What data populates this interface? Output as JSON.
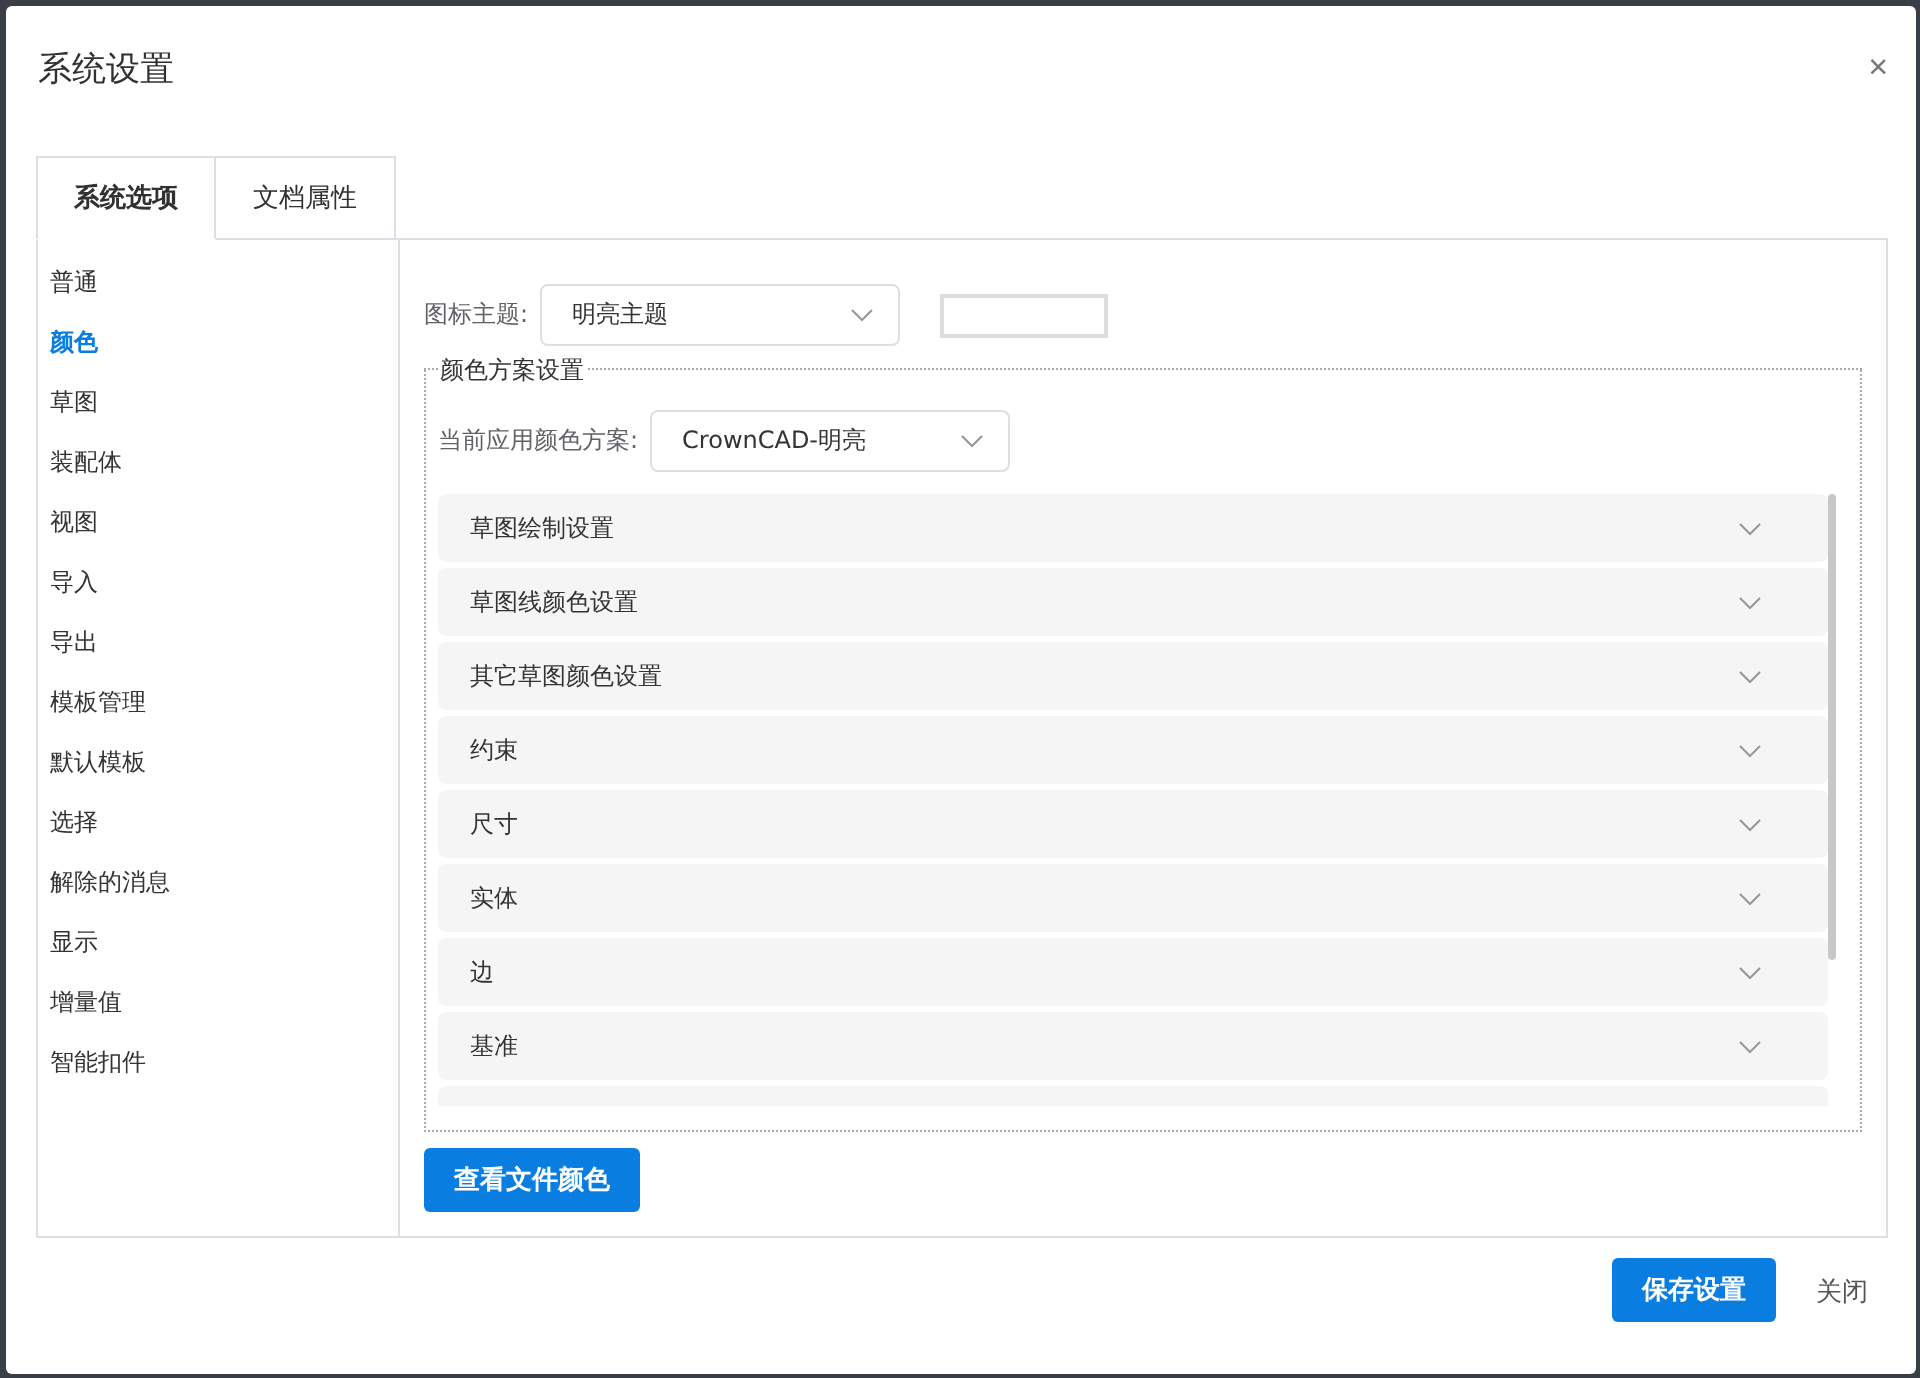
{
  "dialog": {
    "title": "系统设置",
    "close": "×"
  },
  "tabs": [
    {
      "label": "系统选项",
      "selected": true
    },
    {
      "label": "文档属性",
      "selected": false
    }
  ],
  "sidebar": {
    "items": [
      {
        "label": "普通",
        "selected": false
      },
      {
        "label": "颜色",
        "selected": true
      },
      {
        "label": "草图",
        "selected": false
      },
      {
        "label": "装配体",
        "selected": false
      },
      {
        "label": "视图",
        "selected": false
      },
      {
        "label": "导入",
        "selected": false
      },
      {
        "label": "导出",
        "selected": false
      },
      {
        "label": "模板管理",
        "selected": false
      },
      {
        "label": "默认模板",
        "selected": false
      },
      {
        "label": "选择",
        "selected": false
      },
      {
        "label": "解除的消息",
        "selected": false
      },
      {
        "label": "显示",
        "selected": false
      },
      {
        "label": "增量值",
        "selected": false
      },
      {
        "label": "智能扣件",
        "selected": false
      }
    ]
  },
  "icon_theme": {
    "label": "图标主题:",
    "value": "明亮主题"
  },
  "color_scheme": {
    "legend": "颜色方案设置",
    "label": "当前应用颜色方案:",
    "value": "CrownCAD-明亮",
    "sections": [
      {
        "label": "草图绘制设置",
        "expanded": false
      },
      {
        "label": "草图线颜色设置",
        "expanded": false
      },
      {
        "label": "其它草图颜色设置",
        "expanded": false
      },
      {
        "label": "约束",
        "expanded": false
      },
      {
        "label": "尺寸",
        "expanded": false
      },
      {
        "label": "实体",
        "expanded": false
      },
      {
        "label": "边",
        "expanded": false
      },
      {
        "label": "基准",
        "expanded": false
      }
    ]
  },
  "view_file_colors_button": "查看文件颜色",
  "footer": {
    "save": "保存设置",
    "close": "关闭"
  }
}
